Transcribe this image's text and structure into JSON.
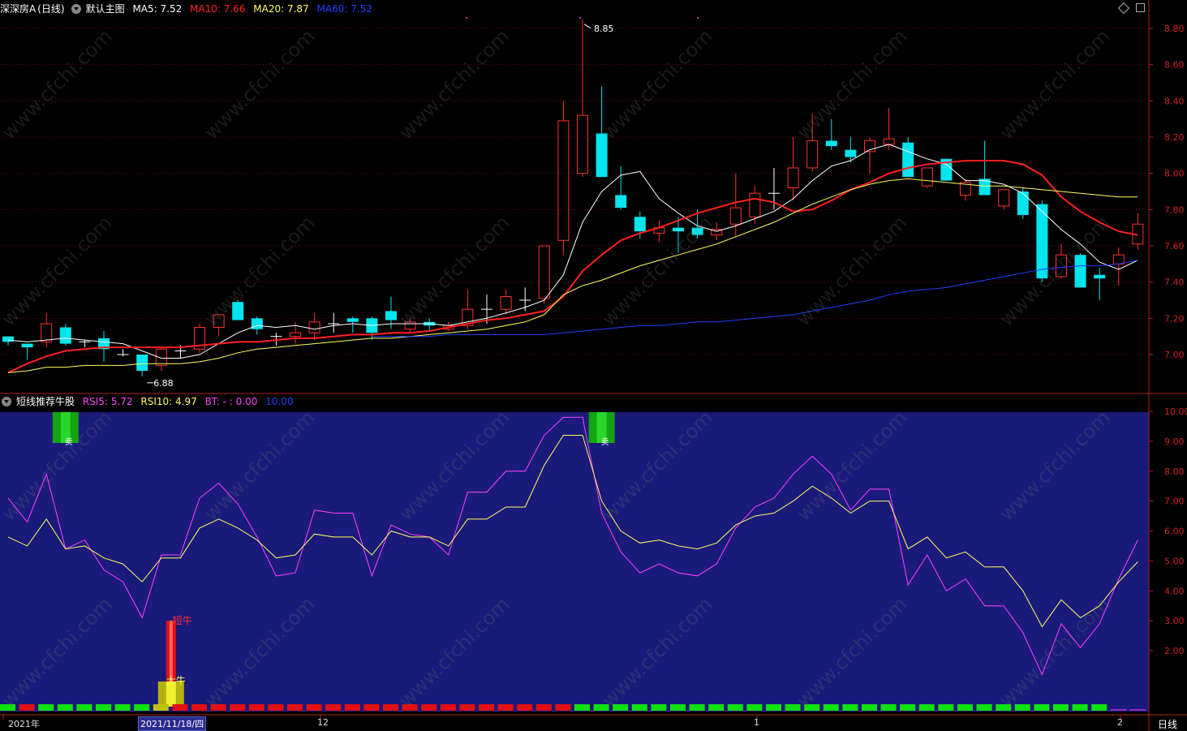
{
  "header": {
    "stock_name": "深深房A",
    "period": "(日线)",
    "template": "默认主图",
    "ma": [
      {
        "label": "MA5: 7.52",
        "color": "#ffffff"
      },
      {
        "label": "MA10: 7.66",
        "color": "#ff2020"
      },
      {
        "label": "MA20: 7.87",
        "color": "#ffff60"
      },
      {
        "label": "MA60: 7.52",
        "color": "#2040ff"
      }
    ]
  },
  "sub_header": {
    "name": "短线推荐牛股",
    "items": [
      {
        "label": "RSI5: 5.72",
        "color": "#ff40ff"
      },
      {
        "label": "RSI10: 4.97",
        "color": "#ffff60"
      },
      {
        "label": "BT: - : 0.00",
        "color": "#ff40ff"
      },
      {
        "label": "10.00",
        "color": "#2040ff"
      }
    ]
  },
  "bottom_bar": {
    "labels": [
      "2021年",
      "2021/11/18/四",
      "12",
      "1",
      "2"
    ],
    "period_label": "日线"
  },
  "price_labels": {
    "high": "8.85",
    "low": "6.88"
  },
  "markers": {
    "sell": "卖",
    "short_bull": "短牛",
    "big_bull": "大牛"
  },
  "watermark": "www.cfchi.com",
  "chart_data": [
    {
      "type": "candlestick",
      "title": "深深房A (日线)",
      "y_ticks": [
        "8.80",
        "8.60",
        "8.40",
        "8.20",
        "8.00",
        "7.80",
        "7.60",
        "7.40",
        "7.20",
        "7.00"
      ],
      "ylim": [
        6.85,
        8.88
      ],
      "grid": true,
      "candles": [
        {
          "o": 7.1,
          "h": 7.1,
          "l": 7.05,
          "c": 7.07
        },
        {
          "o": 7.06,
          "h": 7.06,
          "l": 6.97,
          "c": 7.04
        },
        {
          "o": 7.07,
          "h": 7.23,
          "l": 7.04,
          "c": 7.17
        },
        {
          "o": 7.15,
          "h": 7.17,
          "l": 7.05,
          "c": 7.06
        },
        {
          "o": 7.08,
          "h": 7.08,
          "l": 7.04,
          "c": 7.07
        },
        {
          "o": 7.09,
          "h": 7.13,
          "l": 6.96,
          "c": 7.03
        },
        {
          "o": 7.01,
          "h": 7.03,
          "l": 6.99,
          "c": 7.0
        },
        {
          "o": 7.0,
          "h": 7.0,
          "l": 6.88,
          "c": 6.91
        },
        {
          "o": 6.94,
          "h": 7.04,
          "l": 6.91,
          "c": 7.03
        },
        {
          "o": 7.02,
          "h": 7.05,
          "l": 6.98,
          "c": 7.02
        },
        {
          "o": 7.03,
          "h": 7.17,
          "l": 7.01,
          "c": 7.15
        },
        {
          "o": 7.15,
          "h": 7.22,
          "l": 7.1,
          "c": 7.22
        },
        {
          "o": 7.29,
          "h": 7.3,
          "l": 7.19,
          "c": 7.19
        },
        {
          "o": 7.2,
          "h": 7.21,
          "l": 7.11,
          "c": 7.14
        },
        {
          "o": 7.1,
          "h": 7.12,
          "l": 7.05,
          "c": 7.1
        },
        {
          "o": 7.1,
          "h": 7.18,
          "l": 7.06,
          "c": 7.12
        },
        {
          "o": 7.12,
          "h": 7.23,
          "l": 7.08,
          "c": 7.18
        },
        {
          "o": 7.17,
          "h": 7.23,
          "l": 7.12,
          "c": 7.17
        },
        {
          "o": 7.2,
          "h": 7.21,
          "l": 7.12,
          "c": 7.18
        },
        {
          "o": 7.2,
          "h": 7.21,
          "l": 7.08,
          "c": 7.12
        },
        {
          "o": 7.24,
          "h": 7.32,
          "l": 7.14,
          "c": 7.19
        },
        {
          "o": 7.14,
          "h": 7.2,
          "l": 7.12,
          "c": 7.18
        },
        {
          "o": 7.18,
          "h": 7.2,
          "l": 7.13,
          "c": 7.16
        },
        {
          "o": 7.14,
          "h": 7.18,
          "l": 7.13,
          "c": 7.16
        },
        {
          "o": 7.16,
          "h": 7.36,
          "l": 7.14,
          "c": 7.25
        },
        {
          "o": 7.24,
          "h": 7.33,
          "l": 7.17,
          "c": 7.25
        },
        {
          "o": 7.25,
          "h": 7.36,
          "l": 7.22,
          "c": 7.32
        },
        {
          "o": 7.3,
          "h": 7.37,
          "l": 7.24,
          "c": 7.3
        },
        {
          "o": 7.31,
          "h": 7.6,
          "l": 7.28,
          "c": 7.6
        },
        {
          "o": 7.63,
          "h": 8.4,
          "l": 7.55,
          "c": 8.29
        },
        {
          "o": 8.0,
          "h": 8.85,
          "l": 7.98,
          "c": 8.32
        },
        {
          "o": 8.22,
          "h": 8.48,
          "l": 7.98,
          "c": 7.98
        },
        {
          "o": 7.88,
          "h": 8.04,
          "l": 7.8,
          "c": 7.81
        },
        {
          "o": 7.76,
          "h": 7.79,
          "l": 7.64,
          "c": 7.68
        },
        {
          "o": 7.67,
          "h": 7.74,
          "l": 7.62,
          "c": 7.7
        },
        {
          "o": 7.7,
          "h": 7.76,
          "l": 7.56,
          "c": 7.68
        },
        {
          "o": 7.7,
          "h": 7.8,
          "l": 7.64,
          "c": 7.66
        },
        {
          "o": 7.66,
          "h": 7.73,
          "l": 7.63,
          "c": 7.69
        },
        {
          "o": 7.72,
          "h": 8.0,
          "l": 7.65,
          "c": 7.81
        },
        {
          "o": 7.76,
          "h": 7.93,
          "l": 7.72,
          "c": 7.89
        },
        {
          "o": 7.89,
          "h": 8.03,
          "l": 7.8,
          "c": 7.89
        },
        {
          "o": 7.92,
          "h": 8.2,
          "l": 7.85,
          "c": 8.03
        },
        {
          "o": 8.03,
          "h": 8.33,
          "l": 8.01,
          "c": 8.18
        },
        {
          "o": 8.18,
          "h": 8.3,
          "l": 8.13,
          "c": 8.15
        },
        {
          "o": 8.13,
          "h": 8.2,
          "l": 8.06,
          "c": 8.09
        },
        {
          "o": 8.12,
          "h": 8.2,
          "l": 8.0,
          "c": 8.18
        },
        {
          "o": 8.16,
          "h": 8.36,
          "l": 8.13,
          "c": 8.19
        },
        {
          "o": 8.17,
          "h": 8.2,
          "l": 7.98,
          "c": 7.98
        },
        {
          "o": 7.93,
          "h": 8.03,
          "l": 7.92,
          "c": 8.03
        },
        {
          "o": 8.08,
          "h": 8.08,
          "l": 7.96,
          "c": 7.96
        },
        {
          "o": 7.88,
          "h": 7.97,
          "l": 7.85,
          "c": 7.95
        },
        {
          "o": 7.97,
          "h": 8.18,
          "l": 7.88,
          "c": 7.88
        },
        {
          "o": 7.82,
          "h": 7.91,
          "l": 7.8,
          "c": 7.91
        },
        {
          "o": 7.9,
          "h": 7.92,
          "l": 7.75,
          "c": 7.77
        },
        {
          "o": 7.83,
          "h": 7.85,
          "l": 7.4,
          "c": 7.42
        },
        {
          "o": 7.43,
          "h": 7.61,
          "l": 7.42,
          "c": 7.55
        },
        {
          "o": 7.55,
          "h": 7.56,
          "l": 7.37,
          "c": 7.37
        },
        {
          "o": 7.44,
          "h": 7.48,
          "l": 7.3,
          "c": 7.42
        },
        {
          "o": 7.5,
          "h": 7.59,
          "l": 7.38,
          "c": 7.55
        },
        {
          "o": 7.61,
          "h": 7.78,
          "l": 7.58,
          "c": 7.72
        }
      ],
      "series": [
        {
          "name": "MA5",
          "color": "#ffffff",
          "values": [
            7.08,
            7.07,
            7.08,
            7.09,
            7.08,
            7.07,
            7.06,
            7.02,
            6.98,
            6.98,
            7.0,
            7.06,
            7.12,
            7.16,
            7.15,
            7.16,
            7.14,
            7.16,
            7.17,
            7.16,
            7.17,
            7.17,
            7.17,
            7.16,
            7.18,
            7.2,
            7.23,
            7.26,
            7.3,
            7.44,
            7.73,
            7.9,
            7.99,
            8.01,
            7.86,
            7.78,
            7.71,
            7.68,
            7.71,
            7.75,
            7.79,
            7.86,
            7.96,
            8.04,
            8.07,
            8.13,
            8.16,
            8.12,
            8.08,
            8.05,
            7.96,
            7.96,
            7.94,
            7.89,
            7.79,
            7.69,
            7.61,
            7.51,
            7.47,
            7.52
          ]
        },
        {
          "name": "MA10",
          "color": "#ff2020",
          "values": [
            6.9,
            6.95,
            6.99,
            7.02,
            7.03,
            7.04,
            7.04,
            7.04,
            7.04,
            7.04,
            7.05,
            7.06,
            7.07,
            7.07,
            7.08,
            7.09,
            7.09,
            7.1,
            7.11,
            7.11,
            7.12,
            7.12,
            7.13,
            7.15,
            7.17,
            7.19,
            7.2,
            7.22,
            7.24,
            7.32,
            7.46,
            7.55,
            7.63,
            7.67,
            7.7,
            7.74,
            7.78,
            7.81,
            7.84,
            7.86,
            7.84,
            7.79,
            7.8,
            7.85,
            7.91,
            7.95,
            8.0,
            8.03,
            8.05,
            8.06,
            8.07,
            8.07,
            8.07,
            8.05,
            7.99,
            7.87,
            7.79,
            7.73,
            7.68,
            7.66
          ]
        },
        {
          "name": "MA20",
          "color": "#ffff60",
          "values": [
            6.9,
            6.91,
            6.93,
            6.93,
            6.94,
            6.94,
            6.94,
            6.95,
            6.95,
            6.95,
            6.96,
            6.98,
            7.01,
            7.03,
            7.04,
            7.05,
            7.06,
            7.07,
            7.08,
            7.09,
            7.09,
            7.1,
            7.11,
            7.12,
            7.13,
            7.14,
            7.16,
            7.18,
            7.22,
            7.33,
            7.38,
            7.41,
            7.45,
            7.49,
            7.52,
            7.55,
            7.58,
            7.61,
            7.65,
            7.69,
            7.73,
            7.78,
            7.83,
            7.87,
            7.91,
            7.94,
            7.96,
            7.97,
            7.96,
            7.95,
            7.94,
            7.93,
            7.93,
            7.92,
            7.91,
            7.9,
            7.89,
            7.88,
            7.87,
            7.87
          ]
        },
        {
          "name": "MA60",
          "color": "#2040ff",
          "values": [
            null,
            null,
            null,
            null,
            null,
            null,
            null,
            null,
            null,
            null,
            null,
            null,
            null,
            null,
            null,
            null,
            null,
            null,
            null,
            7.1,
            7.1,
            7.1,
            7.1,
            7.11,
            7.11,
            7.11,
            7.11,
            7.11,
            7.11,
            7.12,
            7.13,
            7.14,
            7.15,
            7.16,
            7.16,
            7.17,
            7.18,
            7.18,
            7.19,
            7.2,
            7.21,
            7.22,
            7.24,
            7.26,
            7.28,
            7.3,
            7.33,
            7.35,
            7.36,
            7.37,
            7.39,
            7.41,
            7.43,
            7.45,
            7.47,
            7.48,
            7.49,
            7.49,
            7.5,
            7.52
          ]
        }
      ]
    },
    {
      "type": "line",
      "title": "短线推荐牛股",
      "y_ticks": [
        "10.00",
        "9.00",
        "8.00",
        "7.00",
        "6.00",
        "5.00",
        "4.00",
        "3.00",
        "2.00"
      ],
      "ylim": [
        0,
        10
      ],
      "series": [
        {
          "name": "RSI5",
          "color": "#ff40ff",
          "values": [
            7.1,
            6.3,
            7.9,
            5.4,
            5.7,
            4.7,
            4.3,
            3.1,
            5.2,
            5.2,
            7.1,
            7.6,
            6.9,
            5.8,
            4.5,
            4.6,
            6.7,
            6.6,
            6.6,
            4.5,
            6.2,
            5.9,
            5.8,
            5.2,
            7.3,
            7.3,
            8.0,
            8.0,
            9.2,
            9.8,
            9.8,
            6.6,
            5.3,
            4.6,
            4.9,
            4.6,
            4.5,
            4.9,
            6.1,
            6.8,
            7.1,
            7.9,
            8.5,
            7.9,
            6.7,
            7.4,
            7.4,
            4.2,
            5.2,
            4.0,
            4.4,
            3.5,
            3.5,
            2.6,
            1.2,
            2.9,
            2.1,
            2.9,
            4.4,
            5.7
          ]
        },
        {
          "name": "RSI10",
          "color": "#ffff60",
          "values": [
            5.8,
            5.5,
            6.4,
            5.4,
            5.5,
            5.1,
            4.9,
            4.3,
            5.1,
            5.1,
            6.1,
            6.4,
            6.1,
            5.7,
            5.1,
            5.2,
            5.9,
            5.8,
            5.8,
            5.2,
            6.0,
            5.8,
            5.8,
            5.5,
            6.4,
            6.4,
            6.8,
            6.8,
            8.2,
            9.2,
            9.2,
            7.0,
            6.0,
            5.6,
            5.7,
            5.5,
            5.4,
            5.6,
            6.2,
            6.5,
            6.6,
            7.0,
            7.5,
            7.1,
            6.6,
            7.0,
            7.0,
            5.4,
            5.8,
            5.1,
            5.3,
            4.8,
            4.8,
            4.0,
            2.8,
            3.7,
            3.1,
            3.5,
            4.3,
            4.97
          ]
        },
        {
          "name": "BT",
          "color": "#ff40ff",
          "values": []
        }
      ],
      "sell_signals": [
        3,
        31
      ],
      "short_bull_index": 8,
      "big_bull_index": 8,
      "bottom_strip": [
        "g",
        "r",
        "g",
        "g",
        "g",
        "g",
        "g",
        "g",
        "y",
        "r",
        "r",
        "r",
        "r",
        "r",
        "r",
        "r",
        "r",
        "r",
        "r",
        "r",
        "r",
        "r",
        "r",
        "r",
        "r",
        "r",
        "r",
        "r",
        "r",
        "r",
        "g",
        "g",
        "g",
        "g",
        "g",
        "g",
        "g",
        "g",
        "g",
        "g",
        "g",
        "g",
        "g",
        "g",
        "g",
        "g",
        "g",
        "g",
        "g",
        "g",
        "g",
        "g",
        "g",
        "g",
        "g",
        "g",
        "g",
        "g",
        "n",
        "n"
      ]
    }
  ]
}
